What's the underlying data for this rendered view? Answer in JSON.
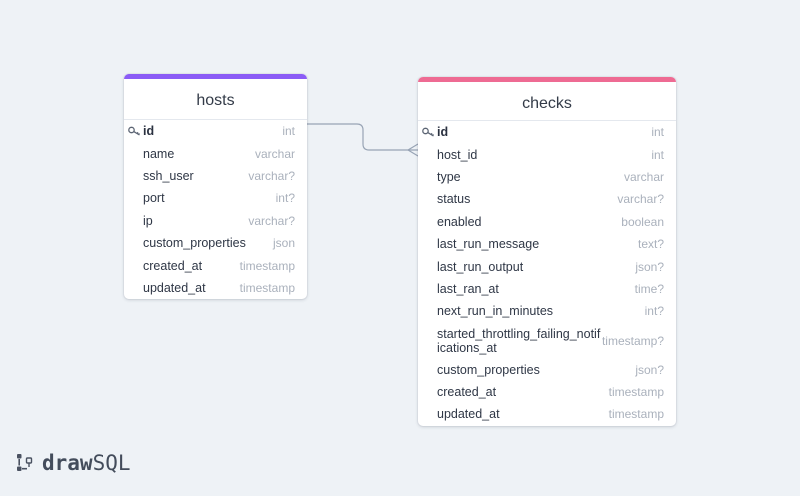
{
  "tables": {
    "hosts": {
      "name": "hosts",
      "accent_color": "#8b5cf6",
      "columns": [
        {
          "name": "id",
          "type": "int",
          "primary_key": true
        },
        {
          "name": "name",
          "type": "varchar"
        },
        {
          "name": "ssh_user",
          "type": "varchar?"
        },
        {
          "name": "port",
          "type": "int?"
        },
        {
          "name": "ip",
          "type": "varchar?"
        },
        {
          "name": "custom_properties",
          "type": "json"
        },
        {
          "name": "created_at",
          "type": "timestamp"
        },
        {
          "name": "updated_at",
          "type": "timestamp"
        }
      ]
    },
    "checks": {
      "name": "checks",
      "accent_color": "#ee6b93",
      "columns": [
        {
          "name": "id",
          "type": "int",
          "primary_key": true
        },
        {
          "name": "host_id",
          "type": "int"
        },
        {
          "name": "type",
          "type": "varchar"
        },
        {
          "name": "status",
          "type": "varchar?"
        },
        {
          "name": "enabled",
          "type": "boolean"
        },
        {
          "name": "last_run_message",
          "type": "text?"
        },
        {
          "name": "last_run_output",
          "type": "json?"
        },
        {
          "name": "last_ran_at",
          "type": "time?"
        },
        {
          "name": "next_run_in_minutes",
          "type": "int?"
        },
        {
          "name": "started_throttling_failing_notifications_at",
          "type": "timestamp?"
        },
        {
          "name": "custom_properties",
          "type": "json?"
        },
        {
          "name": "created_at",
          "type": "timestamp"
        },
        {
          "name": "updated_at",
          "type": "timestamp"
        }
      ]
    }
  },
  "relations": [
    {
      "from": "hosts.id",
      "to": "checks.host_id",
      "cardinality": "one-to-many"
    }
  ],
  "logo": {
    "part1": "draw",
    "part2": "SQL"
  }
}
